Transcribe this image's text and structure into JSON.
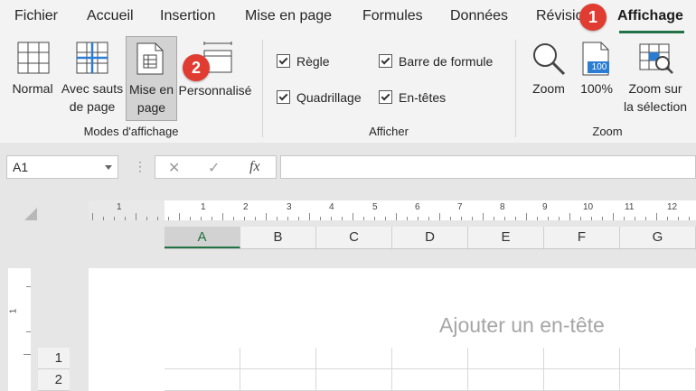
{
  "tabs": [
    {
      "label": "Fichier"
    },
    {
      "label": "Accueil"
    },
    {
      "label": "Insertion"
    },
    {
      "label": "Mise en page"
    },
    {
      "label": "Formules"
    },
    {
      "label": "Données"
    },
    {
      "label": "Révision"
    },
    {
      "label": "Affichage"
    }
  ],
  "badges": {
    "one": "1",
    "two": "2"
  },
  "ribbon": {
    "workbook_views": {
      "group_label": "Modes d'affichage",
      "normal": "Normal",
      "page_break_1": "Avec sauts",
      "page_break_2": "de page",
      "page_layout_1": "Mise en",
      "page_layout_2": "page",
      "custom": "Personnalisé"
    },
    "show": {
      "group_label": "Afficher",
      "ruler": "Règle",
      "formula_bar": "Barre de formule",
      "gridlines": "Quadrillage",
      "headings": "En-têtes"
    },
    "zoom": {
      "group_label": "Zoom",
      "zoom": "Zoom",
      "hundred": "100%",
      "hundred_icon_text": "100",
      "selection_1": "Zoom sur",
      "selection_2": "la sélection"
    }
  },
  "formula_bar": {
    "name_box": "A1",
    "cancel": "✕",
    "enter": "✓",
    "fx": "fx",
    "value": ""
  },
  "sheet": {
    "ruler_numbers": [
      "1",
      "1",
      "2",
      "3",
      "4",
      "5",
      "6",
      "7",
      "8",
      "9",
      "10",
      "11",
      "12"
    ],
    "vertical_ruler_number": "1",
    "columns": [
      "A",
      "B",
      "C",
      "D",
      "E",
      "F",
      "G"
    ],
    "rows": [
      "1",
      "2"
    ],
    "header_placeholder": "Ajouter un en-tête"
  },
  "colors": {
    "accent": "#217346",
    "badge": "#e03c31"
  }
}
